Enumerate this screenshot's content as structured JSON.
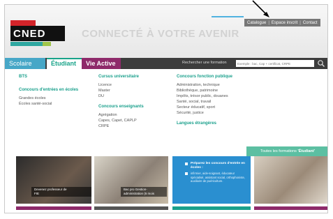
{
  "header": {
    "logo_text": "CNED",
    "tagline": "CONNECTÉ À VOTRE AVENIR",
    "top_links": [
      "Catalogue",
      "Espace inscrit",
      "Contact"
    ]
  },
  "nav": {
    "tabs": [
      "Scolaire",
      "Étudiant",
      "Vie Active"
    ],
    "active_tab": "Étudiant",
    "search_label": "Rechercher une formation",
    "search_placeholder": "Exemple : bac, Cap + certificat, CRPE"
  },
  "menu": {
    "col1": {
      "head1": "BTS",
      "head2": "Concours d'entrées en écoles",
      "items": [
        "Grandes écoles",
        "Écoles santé-social"
      ]
    },
    "col2": {
      "head1": "Cursus universitaire",
      "items1": [
        "Licence",
        "Master",
        "DU"
      ],
      "head2": "Concours enseignants",
      "items2": [
        "Agrégation",
        "Capes, Capet, CAPLP",
        "CRPE"
      ]
    },
    "col3": {
      "head1": "Concours fonction publique",
      "items1": [
        "Administration, technique",
        "Bibliothèque, patrimoine",
        "Impôts, trésor public, douanes",
        "Santé, social, travail",
        "Secteur éducatif, sport",
        "Sécurité, justice"
      ],
      "head2": "Langues étrangères"
    },
    "cta_prefix": "Toutes les formations ",
    "cta_bold": "'Étudiant'"
  },
  "tiles": {
    "t1_caption": [
      "Devenez professeur de",
      "FIE"
    ],
    "t2_caption": [
      "Bac pro Gestion-",
      "administration (6 mois"
    ],
    "t3_title": "Préparez les concours d'entrée en écoles :",
    "t3_text": "infirmier, aide-soignant, éducateur spécialisé, assistant social, orthophoniste, auxiliaire de puériculture."
  },
  "colors": {
    "brand_red": "#d3242a",
    "student_green": "#1aa08c",
    "school_blue": "#47a7c7",
    "vie_active_purple": "#8e2a6a",
    "nav_dark": "#3c3c3c"
  }
}
